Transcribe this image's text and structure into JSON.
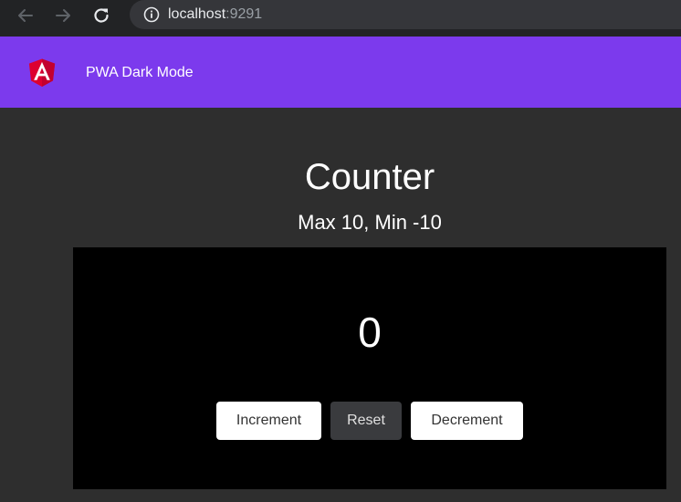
{
  "browser": {
    "url_host": "localhost",
    "url_port": ":9291",
    "icons": {
      "back": "arrow-left-icon",
      "forward": "arrow-right-icon",
      "reload": "reload-icon",
      "site_info": "info-circle-icon"
    }
  },
  "toolbar": {
    "title": "PWA Dark Mode",
    "logo": "angular-logo",
    "color": "#7c3aed"
  },
  "counter": {
    "heading": "Counter",
    "subtitle": "Max 10, Min -10",
    "value": "0",
    "buttons": {
      "increment": "Increment",
      "reset": "Reset",
      "decrement": "Decrement"
    }
  },
  "colors": {
    "page_background": "#2e2e2e",
    "card_background": "#000000",
    "accent": "#7c3aed",
    "logo_red": "#dd0031"
  }
}
